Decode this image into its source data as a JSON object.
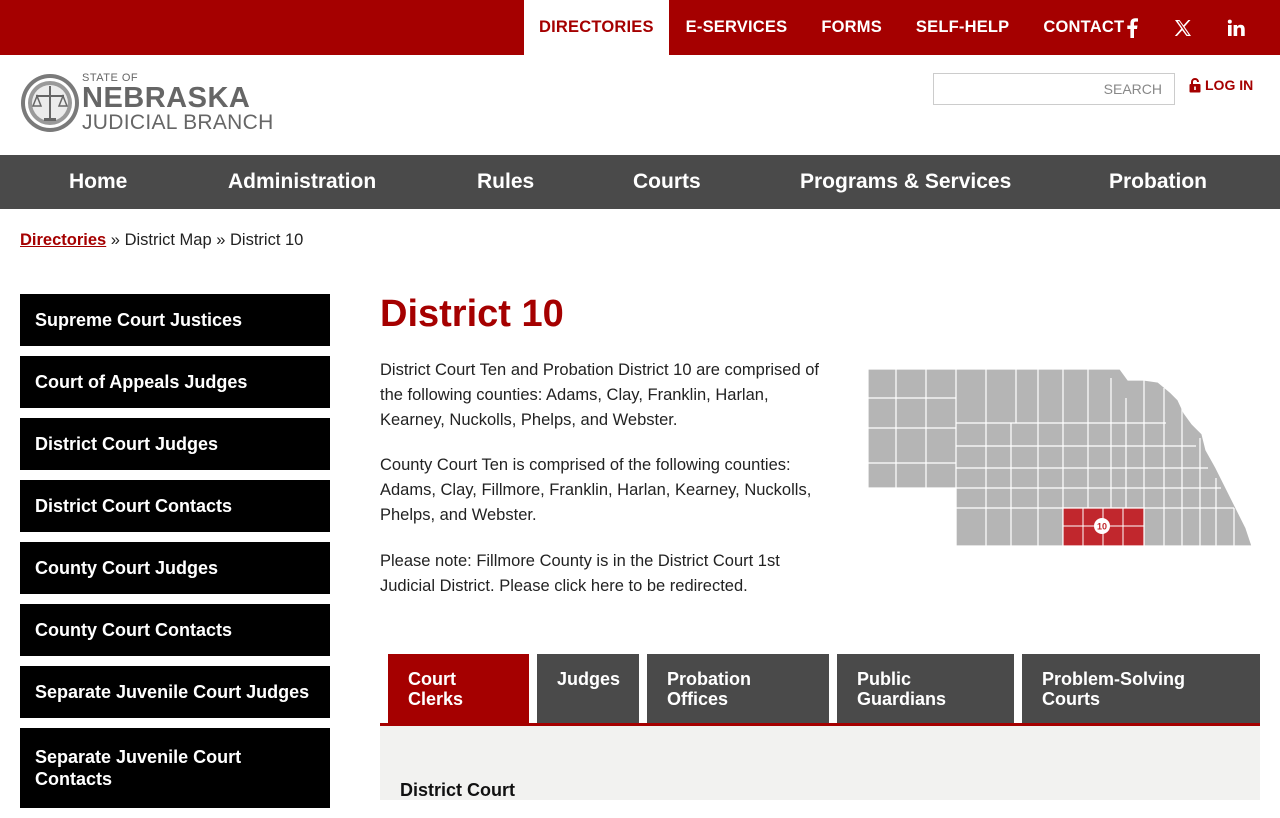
{
  "top_nav": {
    "items": [
      "DIRECTORIES",
      "E-SERVICES",
      "FORMS",
      "SELF-HELP",
      "CONTACT"
    ],
    "social": [
      "facebook-icon",
      "x-icon",
      "linkedin-icon"
    ]
  },
  "logo": {
    "line1": "STATE OF",
    "line2": "NEBRASKA",
    "line3": "JUDICIAL BRANCH"
  },
  "search": {
    "placeholder": "SEARCH"
  },
  "login": {
    "label": "LOG IN"
  },
  "main_nav": [
    "Home",
    "Administration",
    "Rules",
    "Courts",
    "Programs & Services",
    "Probation"
  ],
  "breadcrumb": {
    "link": "Directories",
    "rest": " » District Map » District 10"
  },
  "sidebar": [
    "Supreme Court Justices",
    "Court of Appeals Judges",
    "District Court Judges",
    "District Court Contacts",
    "County Court Judges",
    "County Court Contacts",
    "Separate Juvenile Court Judges",
    "Separate Juvenile Court Contacts"
  ],
  "content": {
    "title": "District 10",
    "p1": "District Court Ten and Probation District 10 are comprised of the following counties: Adams, Clay, Franklin, Harlan, Kearney, Nuckolls, Phelps, and Webster.",
    "p2": "County Court Ten is comprised of the following counties: Adams, Clay, Fillmore, Franklin, Harlan, Kearney, Nuckolls, Phelps, and Webster.",
    "p3": "Please note: Fillmore County is in the District Court 1st Judicial District. Please click here to be redirected."
  },
  "map": {
    "district_label": "10",
    "highlight_color": "#c1272d",
    "base_color": "#b5b5b5"
  },
  "tabs": {
    "items": [
      "Court Clerks",
      "Judges",
      "Probation Offices",
      "Public Guardians",
      "Problem-Solving Courts"
    ],
    "active_index": 0
  },
  "panel": {
    "heading": "District Court"
  },
  "colors": {
    "brand_red": "#a50000",
    "nav_gray": "#4a4a4a"
  }
}
